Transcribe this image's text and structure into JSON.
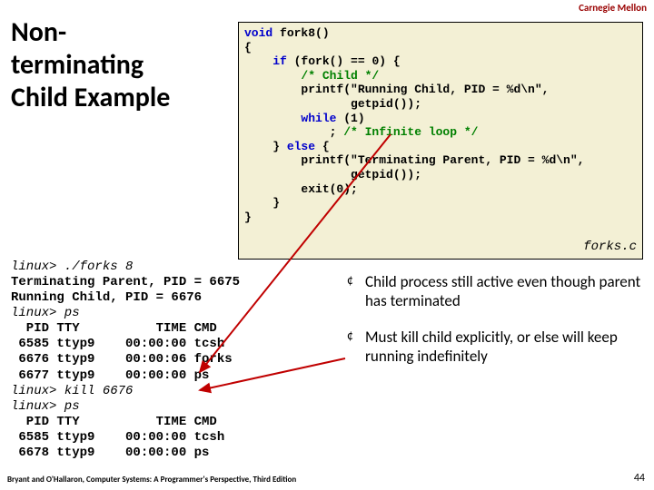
{
  "header": "Carnegie Mellon",
  "title": "Non-\nterminating\nChild Example",
  "code_filename": "forks.c",
  "code": {
    "l1_kw": "void",
    "l1_rest": " fork8()",
    "l2": "{",
    "l3_a": "    ",
    "l3_kw": "if",
    "l3_b": " (fork() == 0) {",
    "l4_a": "        ",
    "l4_cm": "/* Child */",
    "l5": "        printf(\"Running Child, PID = %d\\n\",",
    "l6": "               getpid());",
    "l7_a": "        ",
    "l7_kw": "while",
    "l7_b": " (1)",
    "l8_a": "            ; ",
    "l8_cm": "/* Infinite loop */",
    "l9_a": "    } ",
    "l9_kw": "else",
    "l9_b": " {",
    "l10": "        printf(\"Terminating Parent, PID = %d\\n\",",
    "l11": "               getpid());",
    "l12": "        exit(0);",
    "l13": "    }",
    "l14": "}"
  },
  "terminal": "linux> ./forks 8\nTerminating Parent, PID = 6675\nRunning Child, PID = 6676\nlinux> ps\n  PID TTY          TIME CMD\n 6585 ttyp9    00:00:00 tcsh\n 6676 ttyp9    00:00:06 forks\n 6677 ttyp9    00:00:00 ps\nlinux> kill 6676\nlinux> ps\n  PID TTY          TIME CMD\n 6585 ttyp9    00:00:00 tcsh\n 6678 ttyp9    00:00:00 ps",
  "terminal_lines": [
    {
      "prompt": "linux> ",
      "cmd": "./forks 8"
    },
    {
      "out": "Terminating Parent, PID = 6675"
    },
    {
      "out": "Running Child, PID = 6676"
    },
    {
      "prompt": "linux> ",
      "cmd": "ps"
    },
    {
      "out": "  PID TTY          TIME CMD"
    },
    {
      "out": " 6585 ttyp9    00:00:00 tcsh"
    },
    {
      "out": " 6676 ttyp9    00:00:06 forks"
    },
    {
      "out": " 6677 ttyp9    00:00:00 ps"
    },
    {
      "prompt": "linux> ",
      "cmd": "kill 6676"
    },
    {
      "prompt": "linux> ",
      "cmd": "ps"
    },
    {
      "out": "  PID TTY          TIME CMD"
    },
    {
      "out": " 6585 ttyp9    00:00:00 tcsh"
    },
    {
      "out": " 6678 ttyp9    00:00:00 ps"
    }
  ],
  "bullets": [
    "Child process still active even though parent has terminated",
    "Must kill child explicitly, or else will keep running indefinitely"
  ],
  "footer_left": "Bryant and O'Hallaron, Computer Systems: A Programmer's Perspective, Third Edition",
  "footer_right": "44"
}
